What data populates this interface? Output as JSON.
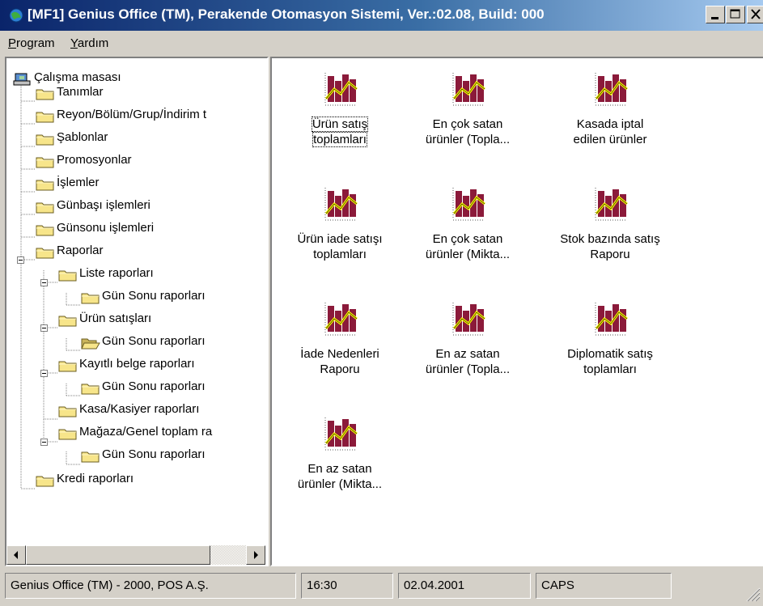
{
  "window": {
    "title": "[MF1] Genius Office (TM), Perakende Otomasyon Sistemi, Ver.:02.08, Build: 000",
    "app_icon": "app-globe-icon",
    "controls": [
      "minimize-icon",
      "maximize-icon",
      "close-icon"
    ]
  },
  "menu": {
    "items": [
      {
        "label": "Program",
        "accel": "P",
        "rest": "rogram"
      },
      {
        "label": "Yardım",
        "accel": "Y",
        "rest": "ardım"
      }
    ]
  },
  "tree": {
    "root": {
      "label": "Çalışma masası",
      "icon": "desktop-icon"
    },
    "nodes": [
      {
        "label": "Tanımlar",
        "icon": "folder-icon"
      },
      {
        "label": "Reyon/Bölüm/Grup/İndirim t",
        "icon": "folder-icon"
      },
      {
        "label": "Şablonlar",
        "icon": "folder-icon"
      },
      {
        "label": "Promosyonlar",
        "icon": "folder-icon"
      },
      {
        "label": "İşlemler",
        "icon": "folder-icon"
      },
      {
        "label": "Günbaşı işlemleri",
        "icon": "folder-icon"
      },
      {
        "label": "Günsonu işlemleri",
        "icon": "folder-icon"
      },
      {
        "label": "Raporlar",
        "icon": "folder-icon",
        "expanded": true
      },
      {
        "label": "Liste raporları",
        "icon": "folder-icon",
        "expanded": true
      },
      {
        "label": "Gün Sonu raporları",
        "icon": "folder-icon"
      },
      {
        "label": "Ürün satışları",
        "icon": "folder-icon",
        "expanded": true
      },
      {
        "label": "Gün Sonu raporları",
        "icon": "open-folder-icon",
        "selected": true
      },
      {
        "label": "Kayıtlı belge raporları",
        "icon": "folder-icon",
        "expanded": true
      },
      {
        "label": "Gün Sonu raporları",
        "icon": "folder-icon"
      },
      {
        "label": "Kasa/Kasiyer raporları",
        "icon": "folder-icon"
      },
      {
        "label": "Mağaza/Genel toplam ra",
        "icon": "folder-icon",
        "expanded": true
      },
      {
        "label": "Gün Sonu raporları",
        "icon": "folder-icon"
      },
      {
        "label": "Kredi raporları",
        "icon": "folder-icon"
      }
    ]
  },
  "reports": {
    "icon": "report-chart-icon",
    "items": [
      {
        "line1": "Ürün satış",
        "line2": "toplamları",
        "focused": true
      },
      {
        "line1": "En çok satan",
        "line2": "ürünler (Topla..."
      },
      {
        "line1": "Kasada iptal",
        "line2": "edilen ürünler"
      },
      {
        "line1": "Ürün iade satışı",
        "line2": "toplamları"
      },
      {
        "line1": "En çok satan",
        "line2": "ürünler (Mikta..."
      },
      {
        "line1": "Stok bazında satış",
        "line2": "Raporu"
      },
      {
        "line1": "İade Nedenleri",
        "line2": "Raporu"
      },
      {
        "line1": "En az satan",
        "line2": "ürünler (Topla..."
      },
      {
        "line1": "Diplomatik satış",
        "line2": "toplamları"
      },
      {
        "line1": "En az satan",
        "line2": "ürünler (Mikta..."
      }
    ]
  },
  "status": {
    "app": "Genius Office (TM) - 2000, POS A.Ş.",
    "time": "16:30",
    "date": "02.04.2001",
    "caps": "CAPS"
  },
  "colors": {
    "title_start": "#0a246a",
    "title_end": "#a6caf0",
    "face": "#d4d0c8",
    "folder": "#f7e58a",
    "chart_bar": "#8b1a3a",
    "chart_line": "#ffff00"
  }
}
